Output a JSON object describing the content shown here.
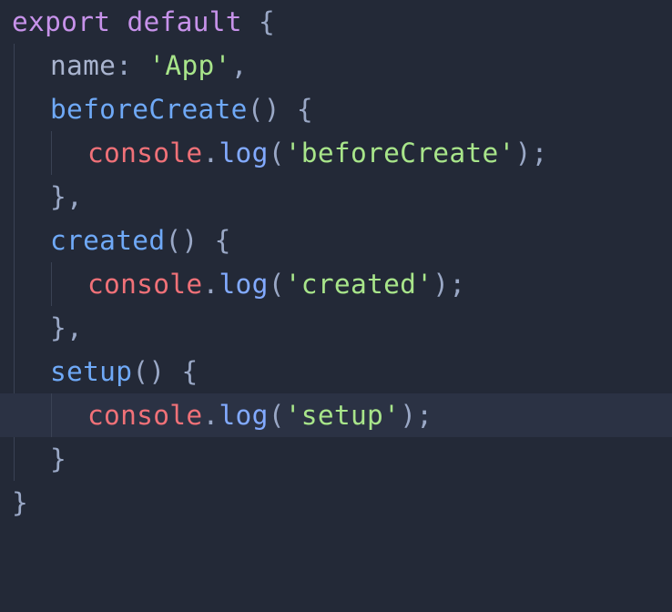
{
  "editor": {
    "colors": {
      "background": "#232937",
      "current_line": "#2b3244",
      "keyword": "#c792ea",
      "function": "#6fa9f7",
      "string": "#a8e58a",
      "object": "#f07178",
      "method": "#82aaff",
      "punctuation": "#9aa8c6"
    },
    "lines": [
      {
        "kw1": "export",
        "kw2": "default",
        "brace": "{"
      },
      {
        "prop": "name",
        "colon": ":",
        "str": "'App'",
        "comma": ","
      },
      {
        "fn": "beforeCreate",
        "parens": "()",
        "brace": "{"
      },
      {
        "obj": "console",
        "dot": ".",
        "method": "log",
        "open": "(",
        "str": "'beforeCreate'",
        "close": ");"
      },
      {
        "close": "},"
      },
      {
        "fn": "created",
        "parens": "()",
        "brace": "{"
      },
      {
        "obj": "console",
        "dot": ".",
        "method": "log",
        "open": "(",
        "str": "'created'",
        "close": ");"
      },
      {
        "close": "},"
      },
      {
        "fn": "setup",
        "parens": "()",
        "brace": "{"
      },
      {
        "obj": "console",
        "dot": ".",
        "method": "log",
        "open": "(",
        "str": "'setup'",
        "close": ");"
      },
      {
        "close": "}"
      },
      {
        "close": "}"
      }
    ]
  }
}
